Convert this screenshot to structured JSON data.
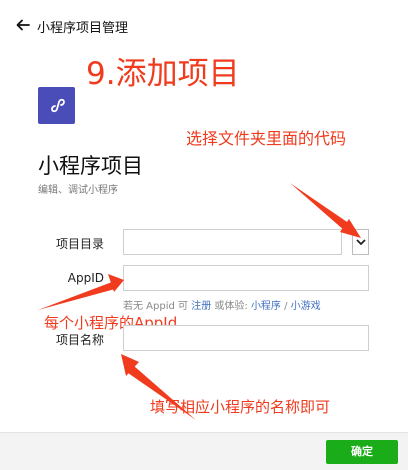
{
  "header": {
    "title": "小程序项目管理",
    "back_icon": "arrow-left-icon"
  },
  "annotations": {
    "step_title": "9.添加项目",
    "pick_folder": "选择文件夹里面的代码",
    "appid_note": "每个小程序的AppId",
    "fill_name": "填写相应小程序的名称即可",
    "fill_name_tail": "。",
    "color": "#f03b1e"
  },
  "app_logo": {
    "icon": "mini-program-logo-icon",
    "color": "#4a4db8"
  },
  "page": {
    "title": "小程序项目",
    "subtitle": "编辑、调试小程序"
  },
  "form": {
    "dir_label": "项目目录",
    "dir_value": "",
    "appid_label": "AppID",
    "appid_value": "",
    "name_label": "项目名称",
    "name_value": "",
    "hint_prefix": "若无 Appid 可 ",
    "hint_register": "注册",
    "hint_mid": " 或体验: ",
    "hint_miniprogram": "小程序",
    "hint_sep": " / ",
    "hint_minigame": "小游戏"
  },
  "footer": {
    "confirm_label": "确定",
    "confirm_color": "#1aad19"
  }
}
